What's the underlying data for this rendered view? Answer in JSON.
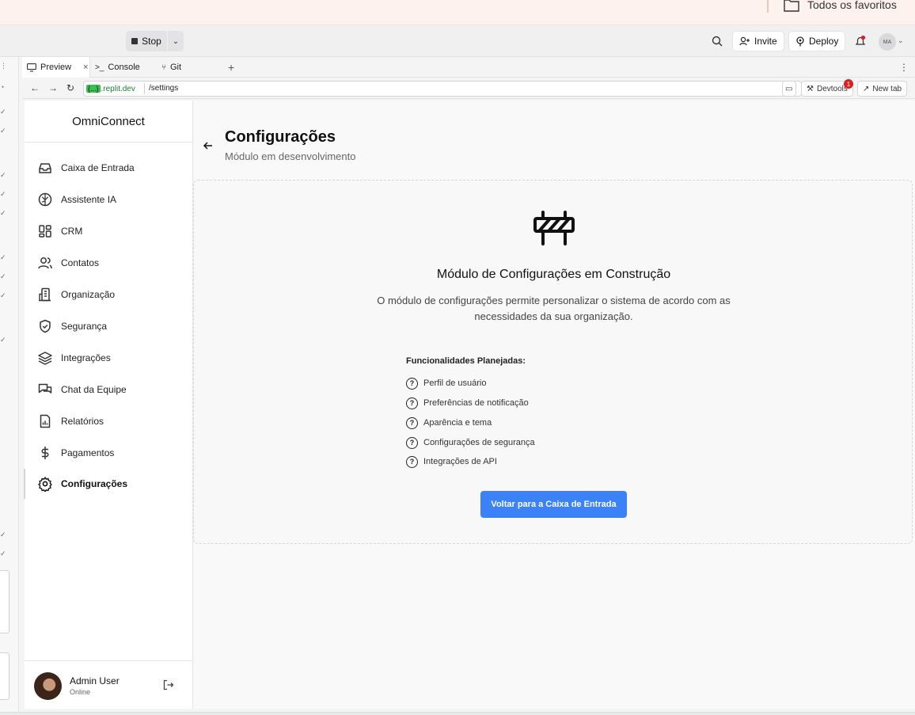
{
  "bookmarks": {
    "all_favorites": "Todos os favoritos"
  },
  "topbar": {
    "stop_label": "Stop",
    "invite_label": "Invite",
    "deploy_label": "Deploy",
    "avatar_initials": "MA"
  },
  "tabs": [
    {
      "label": "Preview"
    },
    {
      "label": "Console"
    },
    {
      "label": "Git"
    }
  ],
  "urlbar": {
    "host_prefix": "{...}",
    "host": ".replit.dev",
    "path": "/settings",
    "devtools_label": "Devtools",
    "devtools_badge": "1",
    "new_tab_label": "New tab"
  },
  "sidebar": {
    "brand": "OmniConnect",
    "items": [
      {
        "label": "Caixa de Entrada",
        "icon": "inbox-icon"
      },
      {
        "label": "Assistente IA",
        "icon": "brain-icon"
      },
      {
        "label": "CRM",
        "icon": "dashboard-icon"
      },
      {
        "label": "Contatos",
        "icon": "users-icon"
      },
      {
        "label": "Organização",
        "icon": "building-icon"
      },
      {
        "label": "Segurança",
        "icon": "shield-check-icon"
      },
      {
        "label": "Integrações",
        "icon": "layers-icon"
      },
      {
        "label": "Chat da Equipe",
        "icon": "chat-icon"
      },
      {
        "label": "Relatórios",
        "icon": "report-icon"
      },
      {
        "label": "Pagamentos",
        "icon": "dollar-icon"
      },
      {
        "label": "Configurações",
        "icon": "gear-icon",
        "active": true
      }
    ],
    "user": {
      "name": "Admin User",
      "status": "Online"
    }
  },
  "main": {
    "title": "Configurações",
    "subtitle": "Módulo em desenvolvimento",
    "panel": {
      "heading": "Módulo de Configurações em Construção",
      "description": "O módulo de configurações permite personalizar o sistema de acordo com as necessidades da sua organização.",
      "features_title": "Funcionalidades Planejadas:",
      "features": [
        "Perfil de usuário",
        "Preferências de notificação",
        "Aparência e tema",
        "Configurações de segurança",
        "Integrações de API"
      ],
      "cta_label": "Voltar para a Caixa de Entrada"
    }
  },
  "colors": {
    "accent": "#3b82f6",
    "badge": "#d92020"
  }
}
